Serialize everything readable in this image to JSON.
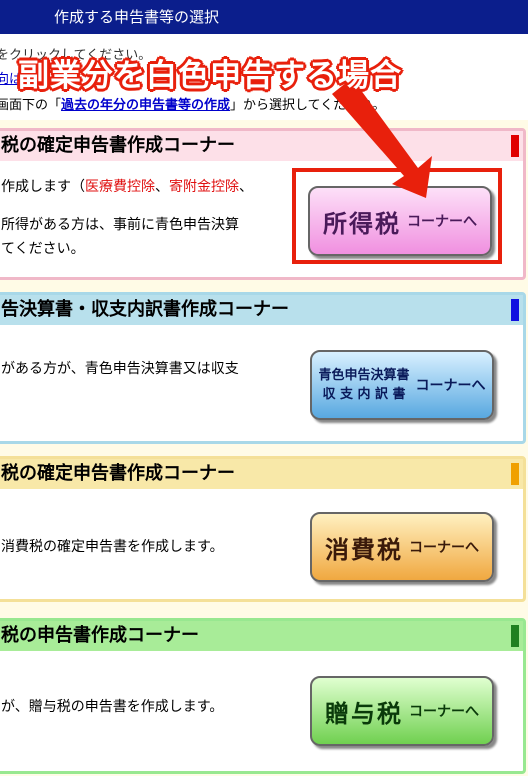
{
  "header": {
    "title": "作成する申告書等の選択"
  },
  "intro": {
    "line1": "をクリックしてください。",
    "line2_link": "向は",
    "line3_prefix": "画面下の「",
    "line3_link": "過去の年分の申告書等の作成",
    "line3_suffix": "」から選択してください。"
  },
  "callout": {
    "text": "副業分を白色申告する場合"
  },
  "panels": [
    {
      "header": "税の確定申告書作成コーナー",
      "line1_prefix": "作成します（",
      "line1_red1": "医療費控除",
      "line1_sep": "、",
      "line1_red2": "寄附金控除",
      "line1_suffix": "、",
      "line2": "所得がある方は、事前に青色申告決算",
      "line3": "てください。",
      "button_main": "所得税",
      "button_sub": "コーナーへ",
      "accent": "#f0b8c8",
      "mark": "#e00000"
    },
    {
      "header": "告決算書・収支内訳書作成コーナー",
      "line1": "がある方が、青色申告決算書又は収支",
      "button_line1": "青色申告決算書",
      "button_line2": "収 支 内 訳 書",
      "button_sub": "コーナーへ",
      "accent": "#a8d8e8",
      "mark": "#1010e0"
    },
    {
      "header": "税の確定申告書作成コーナー",
      "line1": "消費税の確定申告書を作成します。",
      "button_main": "消費税",
      "button_sub": "コーナーへ",
      "accent": "#f4e098",
      "mark": "#f0a000"
    },
    {
      "header": "税の申告書作成コーナー",
      "line1": "が、贈与税の申告書を作成します。",
      "button_main": "贈与税",
      "button_sub": "コーナーへ",
      "accent": "#98e890",
      "mark": "#208020"
    }
  ]
}
